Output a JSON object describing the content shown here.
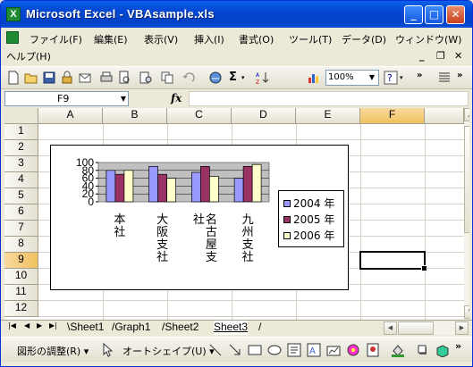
{
  "window": {
    "title": "Microsoft Excel - VBAsample.xls"
  },
  "menu": [
    "ファイル(F)",
    "編集(E)",
    "表示(V)",
    "挿入(I)",
    "書式(O)",
    "ツール(T)",
    "データ(D)",
    "ウィンドウ(W)",
    "ヘルプ(H)"
  ],
  "toolbar": {
    "zoom": "100%"
  },
  "formula_bar": {
    "cell_ref": "F9",
    "fx_label": "fx",
    "content": ""
  },
  "columns": [
    "A",
    "B",
    "C",
    "D",
    "E",
    "F"
  ],
  "rows": [
    "1",
    "2",
    "3",
    "4",
    "5",
    "6",
    "7",
    "8",
    "9",
    "10",
    "11",
    "12"
  ],
  "active_cell": "F9",
  "sheets": [
    "Sheet1",
    "Graph1",
    "Sheet2",
    "Sheet3"
  ],
  "active_sheet": "Sheet3",
  "drawing_toolbar": {
    "draw": "図形の調整(R)",
    "autoshape": "オートシェイプ(U)"
  },
  "chart_data": {
    "type": "bar",
    "categories": [
      "本社",
      "大阪支社",
      "名古屋支社",
      "九州支社"
    ],
    "series": [
      {
        "name": "2004 年",
        "values": [
          80,
          90,
          75,
          60
        ],
        "color": "#9999FF"
      },
      {
        "name": "2005 年",
        "values": [
          70,
          70,
          90,
          90
        ],
        "color": "#993366"
      },
      {
        "name": "2006 年",
        "values": [
          80,
          60,
          65,
          95
        ],
        "color": "#FFFFCC"
      }
    ],
    "ylim": [
      0,
      100
    ],
    "yticks": [
      "100",
      "80",
      "60",
      "40",
      "20",
      "0"
    ],
    "plot_area_color": "#C0C0C0",
    "legend_position": "right"
  }
}
